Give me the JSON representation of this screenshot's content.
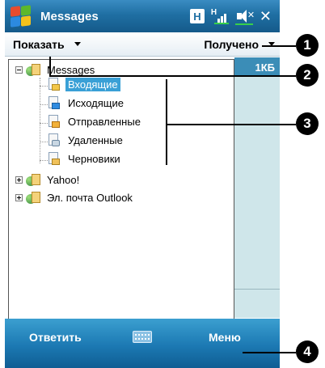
{
  "titlebar": {
    "title": "Messages",
    "connection_badge": "H",
    "signal_text": "H"
  },
  "toolbar": {
    "show_label": "Показать",
    "sort_label": "Получено"
  },
  "tree": {
    "root": "Messages",
    "folders": [
      "Входящие",
      "Исходящие",
      "Отправленные",
      "Удаленные",
      "Черновики"
    ],
    "selected_folder": "Входящие",
    "accounts": [
      "Yahoo!",
      "Эл. почта Outlook"
    ]
  },
  "message_list": {
    "size_header": "1КБ"
  },
  "menubar": {
    "left_softkey": "Ответить",
    "right_softkey": "Меню"
  },
  "callouts": [
    "1",
    "2",
    "3",
    "4"
  ],
  "colors": {
    "titlebar": "#1f6fa3",
    "selection": "#3aa0d6",
    "menubar": "#1c79b3"
  }
}
